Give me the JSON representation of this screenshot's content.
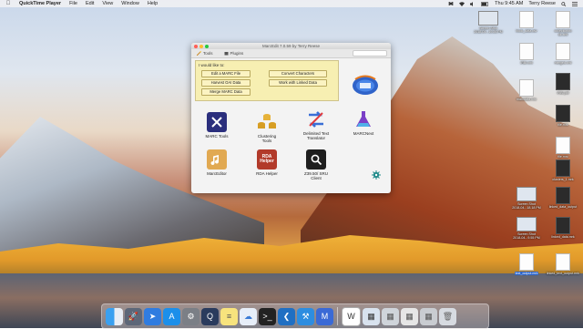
{
  "menubar": {
    "app_name": "QuickTime Player",
    "menus": [
      "File",
      "Edit",
      "View",
      "Window",
      "Help"
    ],
    "clock": "Thu 9:45 AM",
    "user": "Terry Reese"
  },
  "window": {
    "title": "MarcEdit 7.0.59 by Terry Reese",
    "toolbar": {
      "tools_label": "Tools",
      "plugins_label": "Plugins"
    },
    "tasks_label": "I would like to:",
    "task_buttons": [
      "Edit a MARC File",
      "Harvest OAI Data",
      "Merge MARC Data",
      "Convert Characters",
      "Work with Linked Data"
    ],
    "tools": [
      {
        "label": "MARC Tools",
        "icon": "marc-tools-icon",
        "color": "#2b2f7d"
      },
      {
        "label": "Clustering Tools",
        "icon": "clustering-tools-icon",
        "color": "#e6b23a"
      },
      {
        "label": "Delimited Text Translator",
        "icon": "delimited-text-translator-icon",
        "color": "#3a6fd6"
      },
      {
        "label": "MARCNext",
        "icon": "marcnext-flask-icon",
        "color": "#7a3fc7"
      },
      {
        "label": "MarcEditor",
        "icon": "marceditor-icon",
        "color": "#e1a952"
      },
      {
        "label": "RDA Helper",
        "icon": "rda-helper-icon",
        "color": "#b23a2a",
        "icon_text": "RDA\nHelper"
      },
      {
        "label": "Z39.50/ SRU Client",
        "icon": "z3950-search-icon",
        "color": "#1e1e1e"
      }
    ],
    "logo_name": "marcedit-logo-icon",
    "settings_icon": "settings-gear-icon"
  },
  "dock": {
    "apps": [
      "finder-icon",
      "launchpad-icon",
      "safari-icon",
      "app-store-icon",
      "system-preferences-icon",
      "quicktime-icon",
      "notes-icon",
      "cloud-icon",
      "terminal-icon",
      "visual-studio-code-icon",
      "xcode-icon",
      "marcedit-icon",
      "word-icon",
      "preview-icon",
      "trash-icon"
    ]
  },
  "desktop_files": [
    {
      "name": "Screen Shot\n2018-04...19.26 PM"
    },
    {
      "name": "book_data.csv"
    },
    {
      "name": "collectionbo\nok.xml"
    },
    {
      "name": "IRBI.xml"
    },
    {
      "name": "merged.xml"
    },
    {
      "name": "IRBI.pdf"
    },
    {
      "name": "marcdata.mrc"
    },
    {
      "name": "file.mrk"
    },
    {
      "name": "file.mrc"
    },
    {
      "name": "clusters_1.mrk"
    },
    {
      "name": "Screen Shot\n2018-04...18.18 PM"
    },
    {
      "name": "linked_data_output"
    },
    {
      "name": "Screen Shot\n2018-04...9.55 PM"
    },
    {
      "name": "linked_data.mrk"
    },
    {
      "name": "text_output.mrk"
    },
    {
      "name": "linked_text_output.mrk"
    }
  ]
}
